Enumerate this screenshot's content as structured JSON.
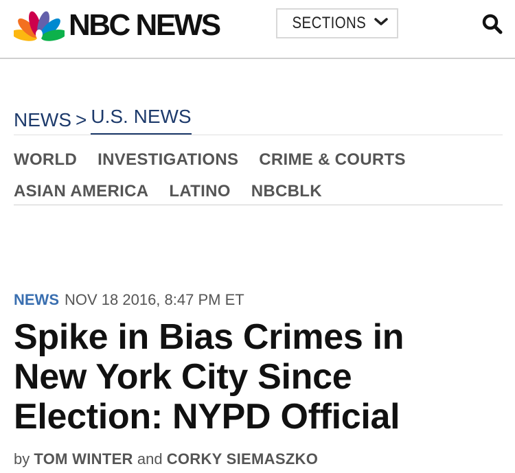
{
  "brand": {
    "name": "NBC NEWS",
    "peacock_colors": [
      "#fcb711",
      "#f37021",
      "#cc004c",
      "#6460aa",
      "#0089d0",
      "#0db14b"
    ]
  },
  "header": {
    "sections_label": "SECTIONS",
    "sections_icon": "chevron-down-icon",
    "search_icon": "search-icon"
  },
  "breadcrumb": {
    "parent": "NEWS",
    "separator": ">",
    "current": "U.S. NEWS"
  },
  "subnav": {
    "row1": [
      "WORLD",
      "INVESTIGATIONS",
      "CRIME & COURTS"
    ],
    "row2": [
      "ASIAN AMERICA",
      "LATINO",
      "NBCBLK"
    ]
  },
  "article": {
    "section": "NEWS",
    "date": "NOV 18 2016, 8:47 PM ET",
    "headline_lines": [
      "Spike in Bias Crimes in",
      "New York City Since",
      "Election: NYPD Official"
    ],
    "byline_prefix": "by",
    "author1": "TOM WINTER",
    "byline_joiner": "and",
    "author2": "CORKY SIEMASZKO"
  },
  "colors": {
    "breadcrumb": "#1d3a6b",
    "section_tag": "#3a6fb0",
    "nav_text": "#555555"
  }
}
